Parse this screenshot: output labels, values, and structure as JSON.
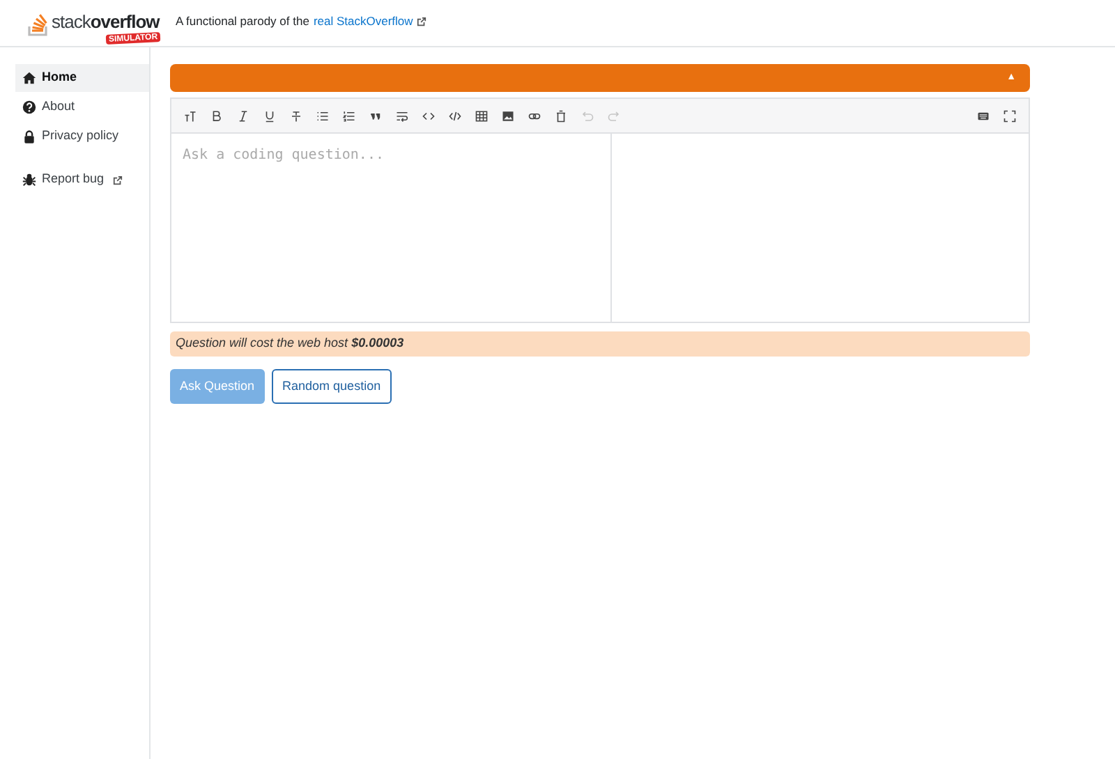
{
  "header": {
    "logo": {
      "word_1": "stack",
      "word_2": "overflow",
      "badge": "SIMULATOR"
    },
    "tagline": "A functional parody of the",
    "tagline_link": "real StackOverflow"
  },
  "sidebar": {
    "items": [
      {
        "label": "Home",
        "kind": "home",
        "selected": true,
        "external": false
      },
      {
        "label": "About",
        "kind": "question",
        "selected": false,
        "external": false
      },
      {
        "label": "Privacy policy",
        "kind": "lock",
        "selected": false,
        "external": false
      },
      {
        "label": "Report bug",
        "kind": "bug",
        "selected": false,
        "external": true
      }
    ]
  },
  "banner": {
    "collapse": "▲"
  },
  "editor": {
    "toolbar": [
      {
        "kind": "heading",
        "disabled": false
      },
      {
        "kind": "bold",
        "disabled": false
      },
      {
        "kind": "italic",
        "disabled": false
      },
      {
        "kind": "underline",
        "disabled": false
      },
      {
        "kind": "strike",
        "disabled": false
      },
      {
        "kind": "ul",
        "disabled": false
      },
      {
        "kind": "ol",
        "disabled": false
      },
      {
        "kind": "quote",
        "disabled": false
      },
      {
        "kind": "wrap",
        "disabled": false
      },
      {
        "kind": "code",
        "disabled": false
      },
      {
        "kind": "codeblock",
        "disabled": false
      },
      {
        "kind": "table",
        "disabled": false
      },
      {
        "kind": "image",
        "disabled": false
      },
      {
        "kind": "link",
        "disabled": false
      },
      {
        "kind": "clear",
        "disabled": false
      },
      {
        "kind": "undo",
        "disabled": true
      },
      {
        "kind": "redo",
        "disabled": true
      }
    ],
    "toolbar_right": [
      {
        "kind": "keyboard",
        "disabled": false
      },
      {
        "kind": "fullscreen",
        "disabled": false
      }
    ],
    "placeholder": "Ask a coding question..."
  },
  "cost_notice": {
    "text": "Question will cost the web host",
    "amount": "$0.00003"
  },
  "buttons": [
    {
      "label": "Ask Question",
      "kind": "primary",
      "disabled": true
    },
    {
      "label": "Random question",
      "kind": "outline",
      "disabled": false
    }
  ]
}
